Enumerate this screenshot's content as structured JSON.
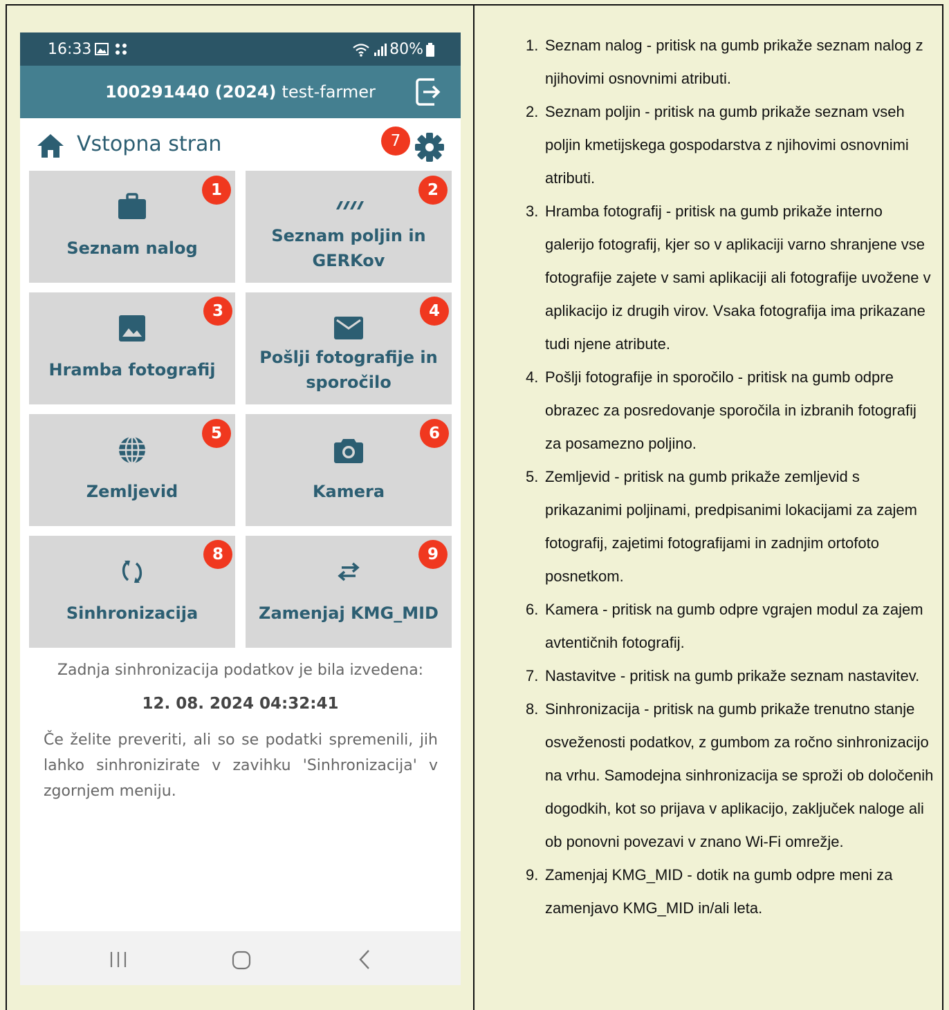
{
  "status_bar": {
    "time": "16:33",
    "battery": "80%",
    "icons": [
      "gallery-icon",
      "grid-icon",
      "wifi-icon",
      "signal-icon",
      "battery-icon"
    ]
  },
  "app_bar": {
    "id_year": "100291440 (2024)",
    "user": "test-farmer",
    "logout_icon": "logout-icon"
  },
  "page": {
    "title": "Vstopna stran",
    "settings_badge": "7"
  },
  "tiles": [
    {
      "badge": "1",
      "label": "Seznam nalog",
      "icon": "briefcase-icon"
    },
    {
      "badge": "2",
      "label": "Seznam poljin in GERKov",
      "icon": "field-icon"
    },
    {
      "badge": "3",
      "label": "Hramba fotografij",
      "icon": "image-icon"
    },
    {
      "badge": "4",
      "label": "Pošlji fotografije in sporočilo",
      "icon": "mail-icon"
    },
    {
      "badge": "5",
      "label": "Zemljevid",
      "icon": "globe-icon"
    },
    {
      "badge": "6",
      "label": "Kamera",
      "icon": "camera-icon"
    },
    {
      "badge": "8",
      "label": "Sinhronizacija",
      "icon": "sync-icon"
    },
    {
      "badge": "9",
      "label": "Zamenjaj KMG_MID",
      "icon": "swap-icon"
    }
  ],
  "sync": {
    "info": "Zadnja sinhronizacija podatkov je bila izvedena:",
    "date": "12. 08. 2024 04:32:41",
    "help": "Če želite preveriti, ali so se podatki spremenili, jih lahko sinhronizirate v zavihku 'Sinhronizacija' v zgornjem meniju."
  },
  "notes": [
    {
      "num": "1.",
      "text": "Seznam nalog - pritisk na gumb prikaže seznam nalog z njihovimi osnovnimi atributi."
    },
    {
      "num": "2.",
      "text": "Seznam poljin - pritisk na gumb prikaže seznam vseh poljin kmetijskega gospodarstva z njihovimi osnovnimi atributi."
    },
    {
      "num": "3.",
      "text": "Hramba fotografij - pritisk na gumb prikaže interno galerijo fotografij, kjer so v aplikaciji varno shranjene vse fotografije zajete v sami aplikaciji ali fotografije uvožene v aplikacijo iz drugih virov. Vsaka fotografija ima prikazane tudi njene atribute."
    },
    {
      "num": "4.",
      "text": "Pošlji fotografije in sporočilo - pritisk na gumb odpre obrazec za posredovanje sporočila in izbranih fotografij za posamezno poljino."
    },
    {
      "num": "5.",
      "text": "Zemljevid - pritisk na gumb prikaže zemljevid s prikazanimi poljinami, predpisanimi lokacijami za zajem fotografij, zajetimi fotografijami in zadnjim ortofoto posnetkom."
    },
    {
      "num": "6.",
      "text": "Kamera - pritisk na gumb odpre vgrajen modul za zajem avtentičnih fotografij."
    },
    {
      "num": "7.",
      "text": "Nastavitve - pritisk na gumb prikaže seznam nastavitev."
    },
    {
      "num": "8.",
      "text": "Sinhronizacija - pritisk na gumb prikaže trenutno stanje osveženosti podatkov, z gumbom za ročno sinhronizacijo na vrhu. Samodejna sinhronizacija se sproži ob določenih dogodkih, kot so prijava v aplikacijo, zaključek naloge ali ob ponovni povezavi v znano Wi-Fi omrežje."
    },
    {
      "num": "9.",
      "text": "Zamenjaj KMG_MID - dotik na gumb odpre meni za zamenjavo KMG_MID in/ali leta."
    }
  ],
  "colors": {
    "background": "#f1f2d5",
    "status_bar": "#2b5566",
    "app_bar": "#447f90",
    "tile": "#d7d7d7",
    "tile_text": "#2c5e72",
    "badge": "#f0381f"
  }
}
